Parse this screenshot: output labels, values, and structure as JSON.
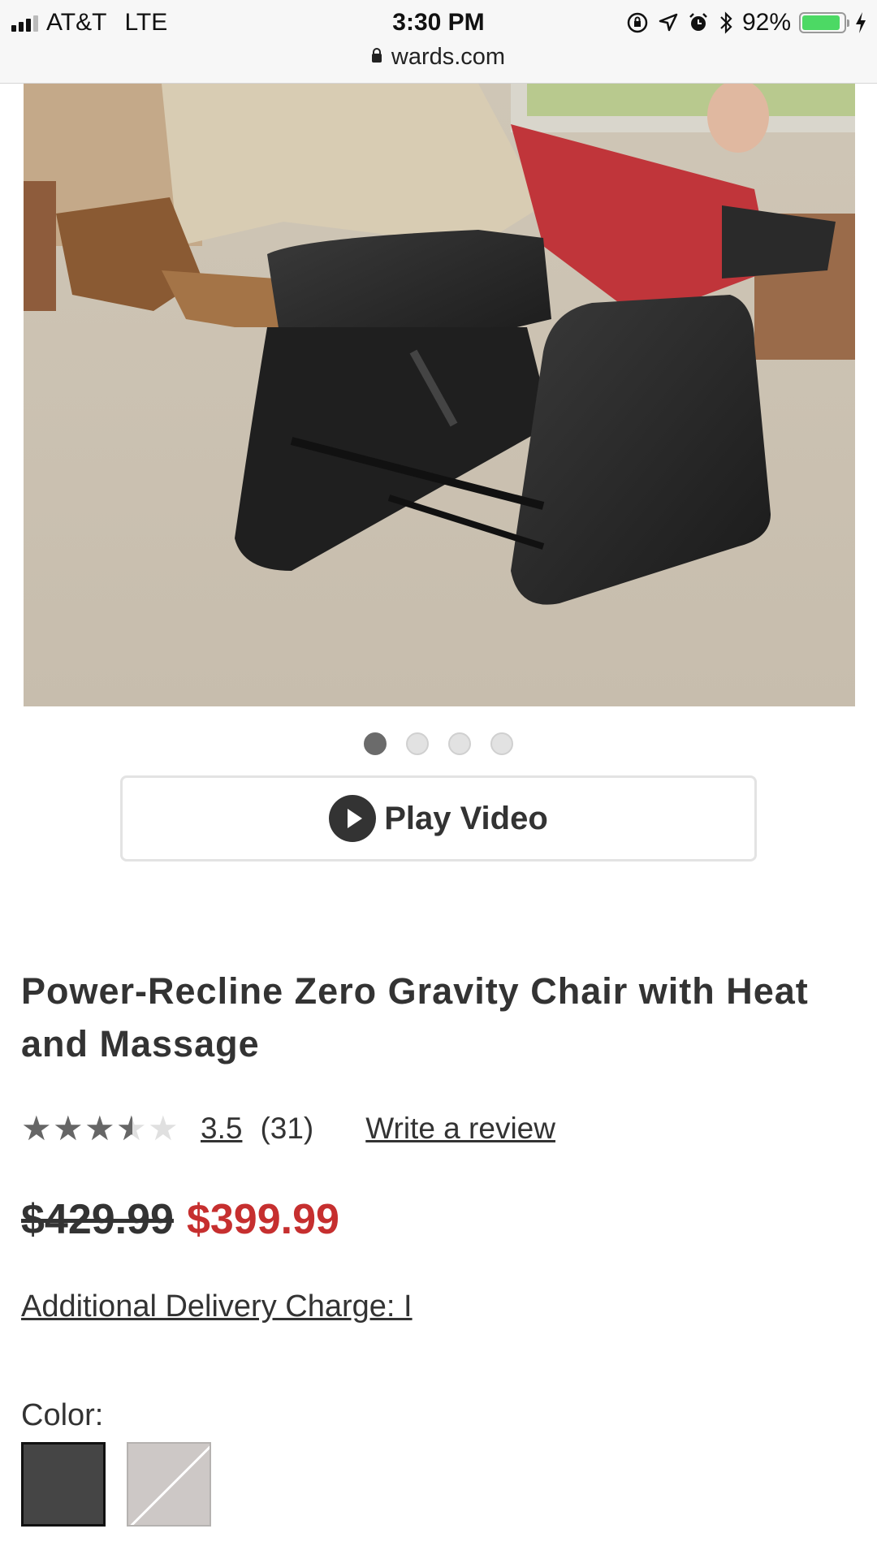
{
  "status_bar": {
    "carrier": "AT&T",
    "network": "LTE",
    "time": "3:30 PM",
    "battery": "92%",
    "battery_level": 0.92,
    "url": "wards.com",
    "icons": [
      "signal-icon",
      "orientation-lock-icon",
      "location-icon",
      "alarm-icon",
      "bluetooth-icon",
      "battery-icon",
      "charging-icon"
    ]
  },
  "gallery": {
    "image_alt": "Man reclining in black zero gravity chair",
    "slide_count": 4,
    "active_slide": 1
  },
  "video": {
    "label": "Play Video"
  },
  "product": {
    "title": "Power-Recline Zero Gravity Chair with Heat and Massage",
    "rating": "3.5",
    "rating_value": 3.5,
    "review_count": "(31)",
    "write_review": "Write a review",
    "price_original": "$429.99",
    "price_sale": "$399.99",
    "delivery": "Additional Delivery Charge: I",
    "color_label": "Color:"
  },
  "colors": {
    "sale_price": "#c62f2f",
    "swatch_dark": "#454545",
    "swatch_light": "#cdc8c6"
  }
}
